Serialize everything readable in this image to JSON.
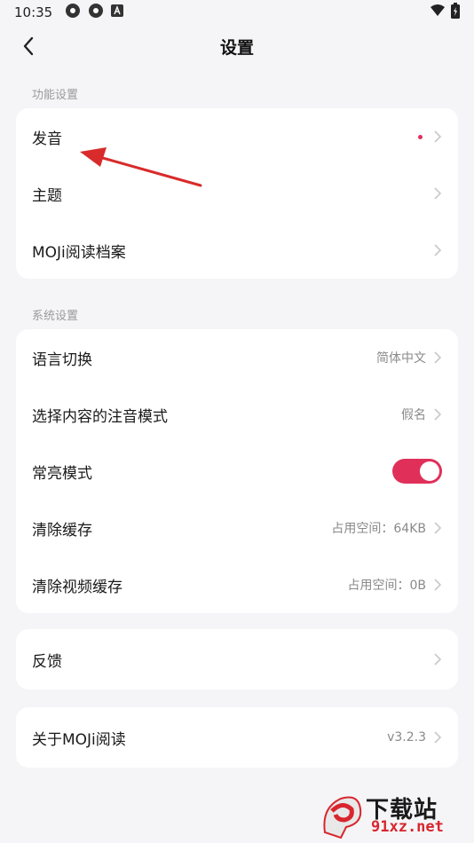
{
  "status_bar": {
    "time": "10:35"
  },
  "header": {
    "title": "设置"
  },
  "sections": {
    "function": {
      "label": "功能设置",
      "items": [
        {
          "label": "发音",
          "has_dot": true
        },
        {
          "label": "主题"
        },
        {
          "label": "MOJi阅读档案"
        }
      ]
    },
    "system": {
      "label": "系统设置",
      "items": [
        {
          "label": "语言切换",
          "value": "简体中文"
        },
        {
          "label": "选择内容的注音模式",
          "value": "假名"
        },
        {
          "label": "常亮模式",
          "toggle": true
        },
        {
          "label": "清除缓存",
          "value": "占用空间：64KB"
        },
        {
          "label": "清除视频缓存",
          "value": "占用空间：0B"
        }
      ]
    },
    "feedback": {
      "items": [
        {
          "label": "反馈"
        }
      ]
    },
    "about": {
      "items": [
        {
          "label": "关于MOJi阅读",
          "value": "v3.2.3"
        }
      ]
    }
  },
  "watermark": {
    "title": "下载站",
    "domain": "91xz.net"
  },
  "colors": {
    "accent": "#e0305a",
    "background": "#f5f5f7",
    "card": "#ffffff",
    "annotation_arrow": "#d92b2b"
  }
}
